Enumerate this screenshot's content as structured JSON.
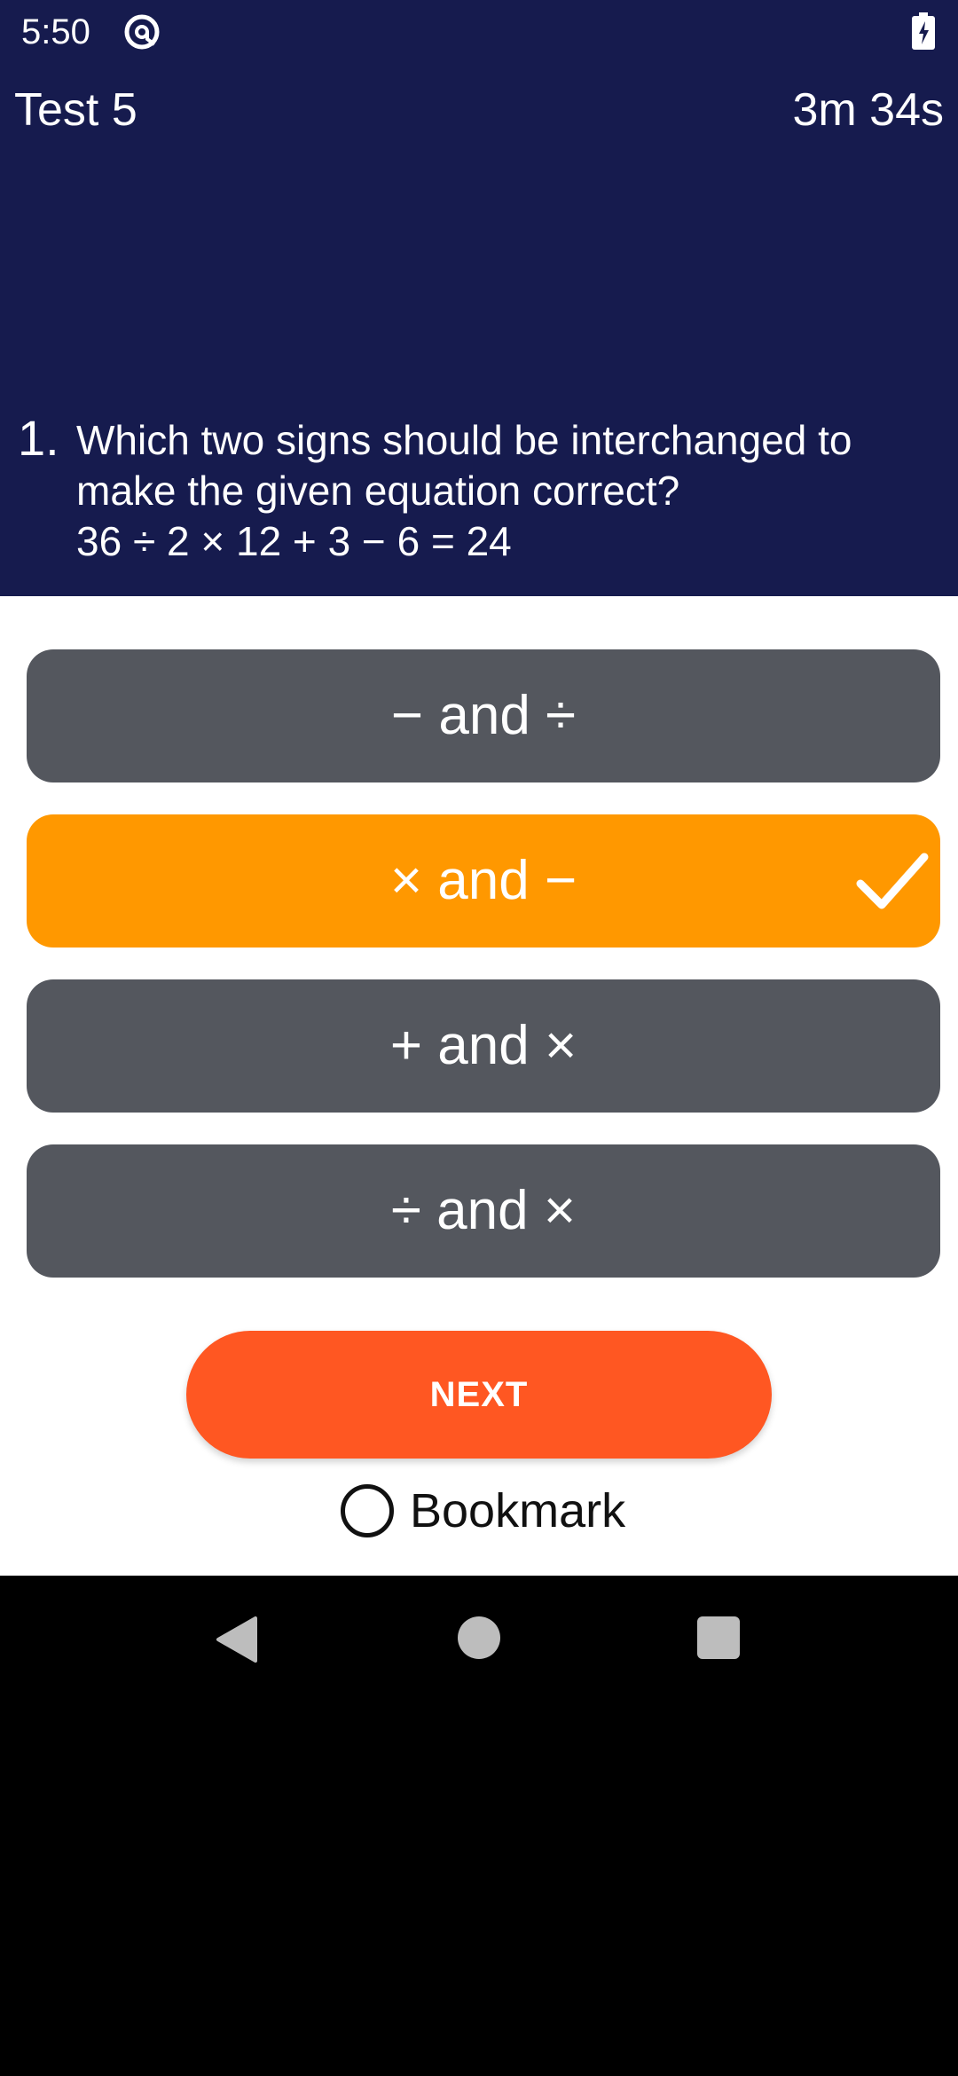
{
  "status_bar": {
    "time": "5:50",
    "app_icon": "at-sign-icon",
    "battery_icon": "battery-charging-icon"
  },
  "header": {
    "title": "Test 5",
    "timer": "3m 34s"
  },
  "question": {
    "number": "1.",
    "line1": "Which two signs should be interchanged to",
    "line2": "make the given equation correct?",
    "equation": "36 ÷ 2 × 12 + 3 − 6 = 24"
  },
  "options": [
    {
      "label": "− and ÷",
      "selected": false
    },
    {
      "label": "× and −",
      "selected": true
    },
    {
      "label": "+ and ×",
      "selected": false
    },
    {
      "label": "÷ and ×",
      "selected": false
    }
  ],
  "actions": {
    "next_label": "NEXT",
    "bookmark_label": "Bookmark"
  },
  "colors": {
    "header_bg": "#161B4E",
    "option_bg": "#54575E",
    "option_selected_bg": "#FF9800",
    "next_bg": "#FF5722"
  },
  "navbar": {
    "back_icon": "back-triangle-icon",
    "home_icon": "home-circle-icon",
    "recent_icon": "recent-apps-square-icon"
  }
}
